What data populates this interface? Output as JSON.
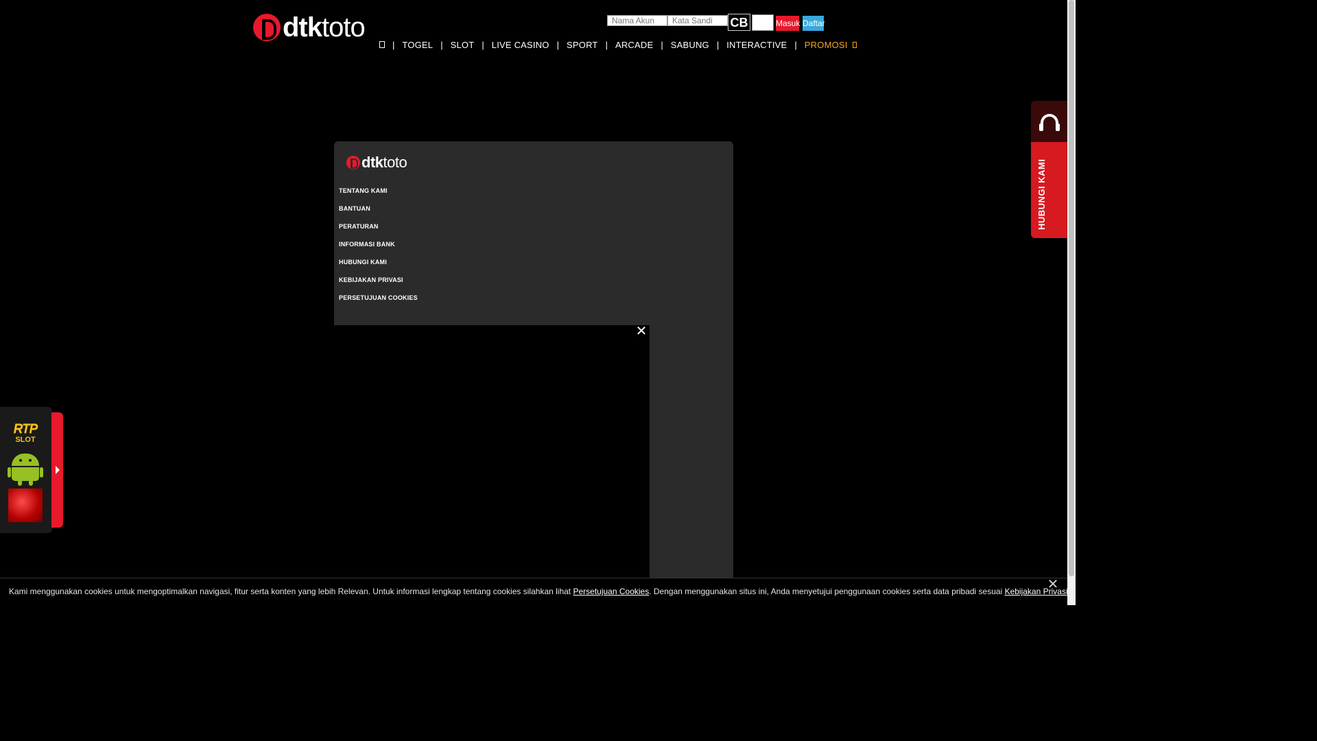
{
  "brand": {
    "logo_bold": "dtk",
    "logo_thin": "toto"
  },
  "login": {
    "username_placeholder": "Nama Akun",
    "password_placeholder": "Kata Sandi",
    "captcha_text": "CB",
    "login_label": "Masuk",
    "register_label": "Daftar"
  },
  "nav": {
    "items": [
      "TOGEL",
      "SLOT",
      "LIVE CASINO",
      "SPORT",
      "ARCADE",
      "SABUNG",
      "INTERACTIVE"
    ],
    "promo_label": "PROMOSI",
    "separator": "|"
  },
  "footer_menu": {
    "items": [
      "TENTANG KAMI",
      "BANTUAN",
      "PERATURAN",
      "INFORMASI BANK",
      "HUBUNGI KAMI",
      "KEBIJAKAN PRIVASI",
      "PERSETUJUAN COOKIES"
    ]
  },
  "video": {
    "close_icon": "close-icon"
  },
  "contact": {
    "label": "HUBUNGI KAMI"
  },
  "side_widget": {
    "rtp_line1": "RTP",
    "rtp_line2": "SLOT"
  },
  "cookie": {
    "text_before": "Kami menggunakan cookies untuk mengoptimalkan navigasi, fitur serta konten yang lebih Relevan. Untuk informasi lengkap tentang cookies silahkan lihat ",
    "link1": "Persetujuan Cookies",
    "text_middle": ". Dengan menggunakan situs ini, Anda menyetujui penggunaan cookies serta data pribadi sesuai ",
    "link2": "Kebijakan Privasi",
    "text_after": "."
  },
  "colors": {
    "accent": "#e8192c",
    "register": "#37a9dc",
    "promo": "#f5a623"
  }
}
